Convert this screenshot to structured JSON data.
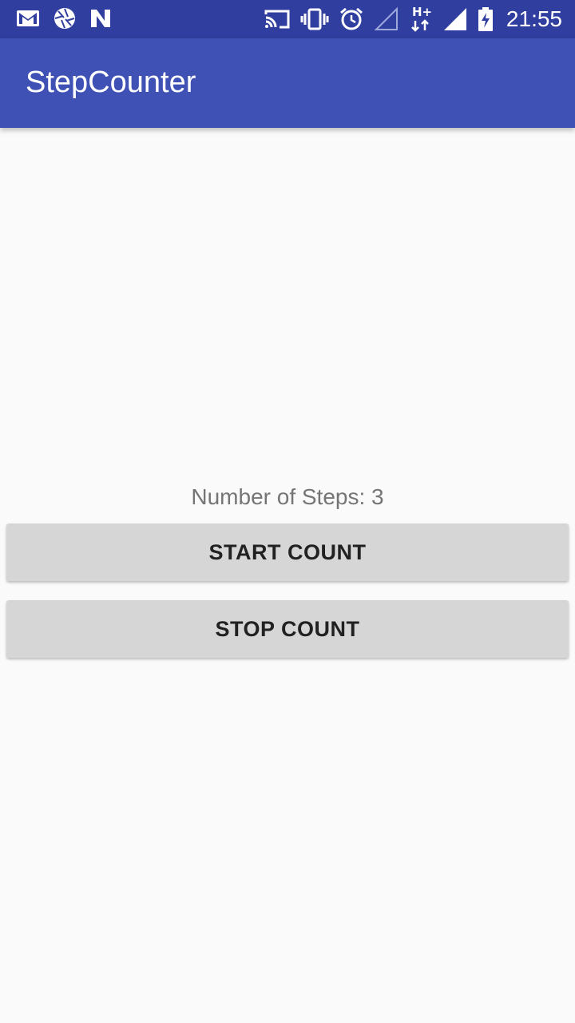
{
  "status_bar": {
    "time": "21:55",
    "network_type": "H+",
    "left_icons": [
      "gmail-icon",
      "aperture-icon",
      "n-icon"
    ],
    "right_icons": [
      "cast-icon",
      "vibrate-icon",
      "alarm-icon",
      "signal-empty-icon",
      "data-arrows-icon",
      "signal-icon",
      "battery-charging-icon"
    ],
    "background_color": "#303f9f"
  },
  "app_bar": {
    "title": "StepCounter",
    "background_color": "#3f51b5"
  },
  "main": {
    "step_text": "Number of Steps: 3",
    "start_button_label": "START COUNT",
    "stop_button_label": "STOP COUNT"
  }
}
